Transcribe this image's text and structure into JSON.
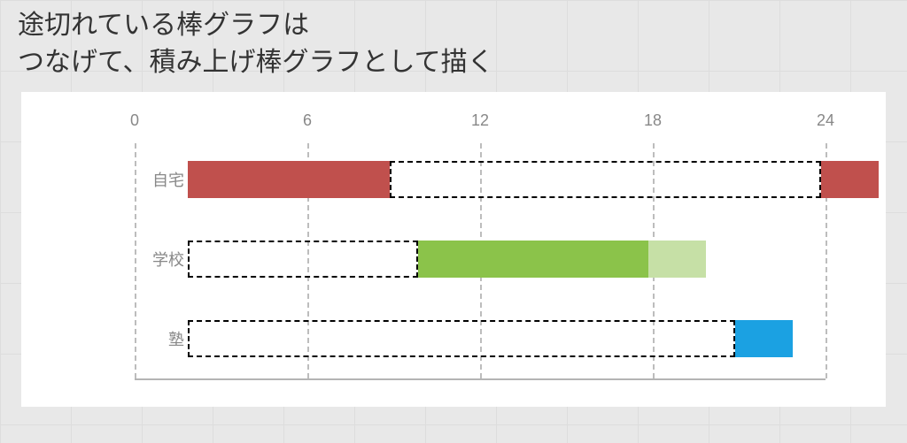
{
  "heading": "途切れている棒グラフは\nつなげて、積み上げ棒グラフとして描く",
  "chart_data": {
    "type": "bar",
    "orientation": "horizontal",
    "xlabel": "",
    "ylabel": "",
    "xlim": [
      0,
      24
    ],
    "xticks": [
      0,
      6,
      12,
      18,
      24
    ],
    "categories": [
      "自宅",
      "学校",
      "塾"
    ],
    "series": [
      {
        "name": "自宅",
        "segments": [
          {
            "start": 0,
            "end": 7,
            "fill": "#c0504d",
            "style": "solid"
          },
          {
            "start": 7,
            "end": 22,
            "fill": null,
            "style": "dashed"
          },
          {
            "start": 22,
            "end": 24,
            "fill": "#c0504d",
            "style": "solid"
          }
        ]
      },
      {
        "name": "学校",
        "segments": [
          {
            "start": 0,
            "end": 8,
            "fill": null,
            "style": "dashed"
          },
          {
            "start": 8,
            "end": 16,
            "fill": "#8bc34a",
            "style": "solid"
          },
          {
            "start": 16,
            "end": 18,
            "fill": "#c6e0a6",
            "style": "solid"
          }
        ]
      },
      {
        "name": "塾",
        "segments": [
          {
            "start": 0,
            "end": 19,
            "fill": null,
            "style": "dashed"
          },
          {
            "start": 19,
            "end": 21,
            "fill": "#1ba1e2",
            "style": "solid"
          }
        ]
      }
    ],
    "colors": {
      "home": "#c0504d",
      "school": "#8bc34a",
      "school_light": "#c6e0a6",
      "cram": "#1ba1e2"
    }
  }
}
